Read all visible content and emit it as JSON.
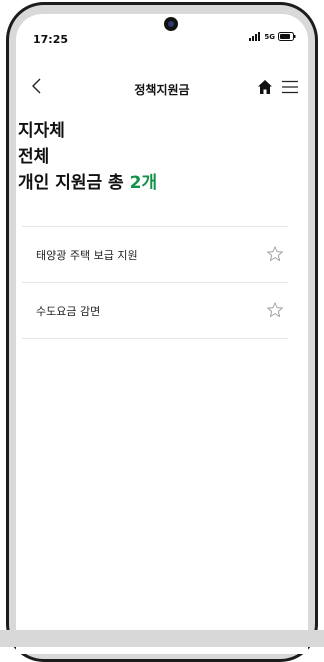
{
  "status_bar": {
    "time": "17:25",
    "network": "5G"
  },
  "header": {
    "title": "정책지원금",
    "back_icon": "chevron-left-icon",
    "home_icon": "home-icon",
    "menu_icon": "hamburger-menu-icon"
  },
  "summary": {
    "region": "지자체",
    "scope": "전체",
    "count_prefix": "개인 지원금 총 ",
    "count": "2개"
  },
  "list": {
    "items": [
      {
        "label": "태양광 주택 보급 지원",
        "favorite": false
      },
      {
        "label": "수도요금 감면",
        "favorite": false
      }
    ]
  },
  "colors": {
    "accent": "#14924a",
    "divider": "#e6e6e6",
    "text": "#111111"
  }
}
